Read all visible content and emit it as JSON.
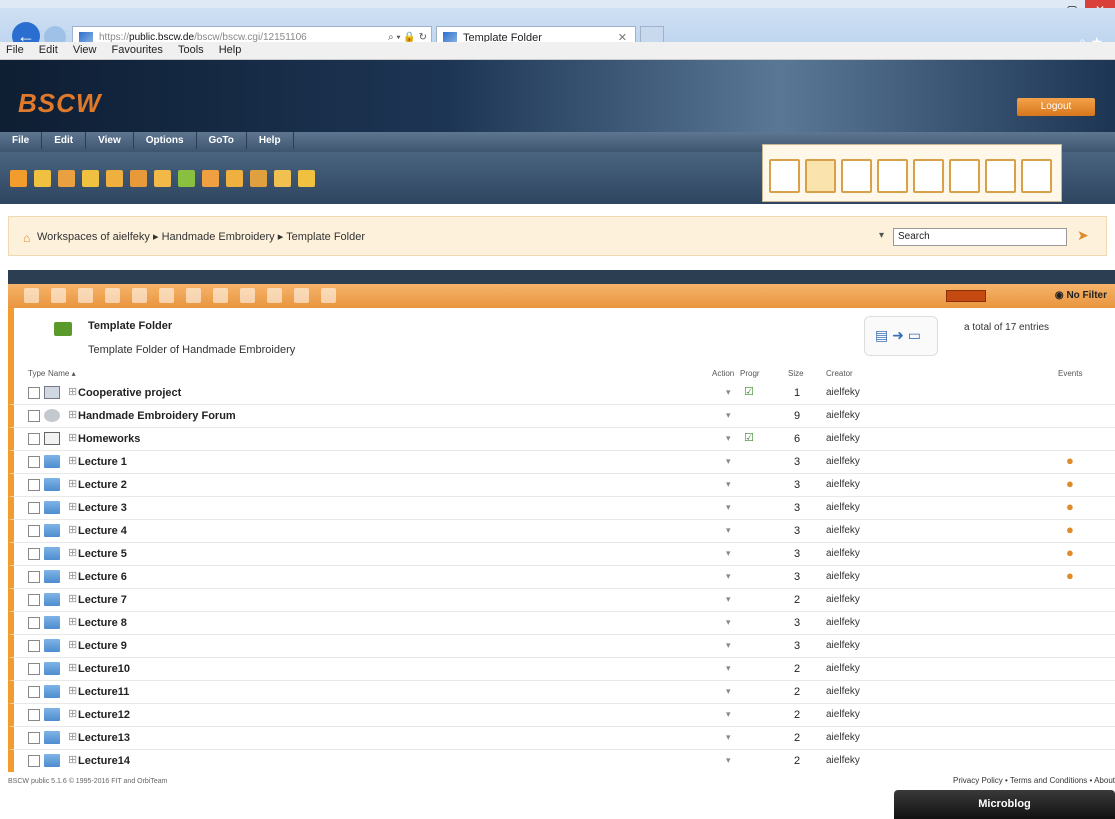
{
  "browser": {
    "url": "https://public.bscw.de/bscw/bscw.cgi/12151106",
    "url_host": "public.bscw.de",
    "url_prefix": "https://",
    "url_path": "/bscw/bscw.cgi/12151106",
    "address_controls": "⌕ ▾ 🔒 ↻",
    "tab_title": "Template Folder",
    "menu": [
      "File",
      "Edit",
      "View",
      "Favourites",
      "Tools",
      "Help"
    ]
  },
  "app": {
    "logo": "BSCW",
    "logout": "Logout",
    "menu": [
      "File",
      "Edit",
      "View",
      "Options",
      "GoTo",
      "Help"
    ],
    "toolbar_icons": [
      "folder-icon",
      "new-icon",
      "edit-icon",
      "users-icon",
      "doc-icon",
      "copy-icon",
      "puzzle-icon",
      "tag-icon",
      "chart-icon",
      "mail-icon",
      "calendar-icon",
      "export-icon",
      "note-icon"
    ],
    "accent": "#e08a2a"
  },
  "breadcrumb": {
    "items": [
      "Workspaces of aielfeky",
      "Handmade Embroidery",
      "Template Folder"
    ],
    "separator": "▸",
    "search_label": "▾",
    "search_placeholder": "Search"
  },
  "list_toolbar": {
    "filter": "No Filter"
  },
  "folder": {
    "title": "Template Folder",
    "description": "Template Folder of Handmade Embroidery",
    "total": "a total of 17 entries"
  },
  "table": {
    "headers": {
      "type": "Type",
      "name": "Name ▴",
      "action": "Action",
      "prog": "Progr",
      "size": "Size",
      "creator": "Creator",
      "events": "Events"
    },
    "rows": [
      {
        "type": "proj",
        "name": "Cooperative project",
        "prog": "☑",
        "size": "1",
        "creator": "aielfeky",
        "event": ""
      },
      {
        "type": "forum",
        "name": "Handmade Embroidery Forum",
        "prog": "",
        "size": "9",
        "creator": "aielfeky",
        "event": ""
      },
      {
        "type": "hw",
        "name": "Homeworks",
        "prog": "☑",
        "size": "6",
        "creator": "aielfeky",
        "event": ""
      },
      {
        "type": "folder",
        "name": "Lecture 1",
        "prog": "",
        "size": "3",
        "creator": "aielfeky",
        "event": "●"
      },
      {
        "type": "folder",
        "name": "Lecture 2",
        "prog": "",
        "size": "3",
        "creator": "aielfeky",
        "event": "●"
      },
      {
        "type": "folder",
        "name": "Lecture 3",
        "prog": "",
        "size": "3",
        "creator": "aielfeky",
        "event": "●"
      },
      {
        "type": "folder",
        "name": "Lecture 4",
        "prog": "",
        "size": "3",
        "creator": "aielfeky",
        "event": "●"
      },
      {
        "type": "folder",
        "name": "Lecture 5",
        "prog": "",
        "size": "3",
        "creator": "aielfeky",
        "event": "●"
      },
      {
        "type": "folder",
        "name": "Lecture 6",
        "prog": "",
        "size": "3",
        "creator": "aielfeky",
        "event": "●"
      },
      {
        "type": "folder",
        "name": "Lecture 7",
        "prog": "",
        "size": "2",
        "creator": "aielfeky",
        "event": ""
      },
      {
        "type": "folder",
        "name": "Lecture 8",
        "prog": "",
        "size": "3",
        "creator": "aielfeky",
        "event": ""
      },
      {
        "type": "folder",
        "name": "Lecture 9",
        "prog": "",
        "size": "3",
        "creator": "aielfeky",
        "event": ""
      },
      {
        "type": "folder",
        "name": "Lecture10",
        "prog": "",
        "size": "2",
        "creator": "aielfeky",
        "event": ""
      },
      {
        "type": "folder",
        "name": "Lecture11",
        "prog": "",
        "size": "2",
        "creator": "aielfeky",
        "event": ""
      },
      {
        "type": "folder",
        "name": "Lecture12",
        "prog": "",
        "size": "2",
        "creator": "aielfeky",
        "event": ""
      },
      {
        "type": "folder",
        "name": "Lecture13",
        "prog": "",
        "size": "2",
        "creator": "aielfeky",
        "event": ""
      },
      {
        "type": "folder",
        "name": "Lecture14",
        "prog": "",
        "size": "2",
        "creator": "aielfeky",
        "event": ""
      }
    ]
  },
  "footer": {
    "copyright": "BSCW public 5.1.6 © 1995-2016 FIT and OrbiTeam",
    "privacy": "Privacy Policy • Terms and Conditions • About",
    "microblog": "Microblog"
  }
}
